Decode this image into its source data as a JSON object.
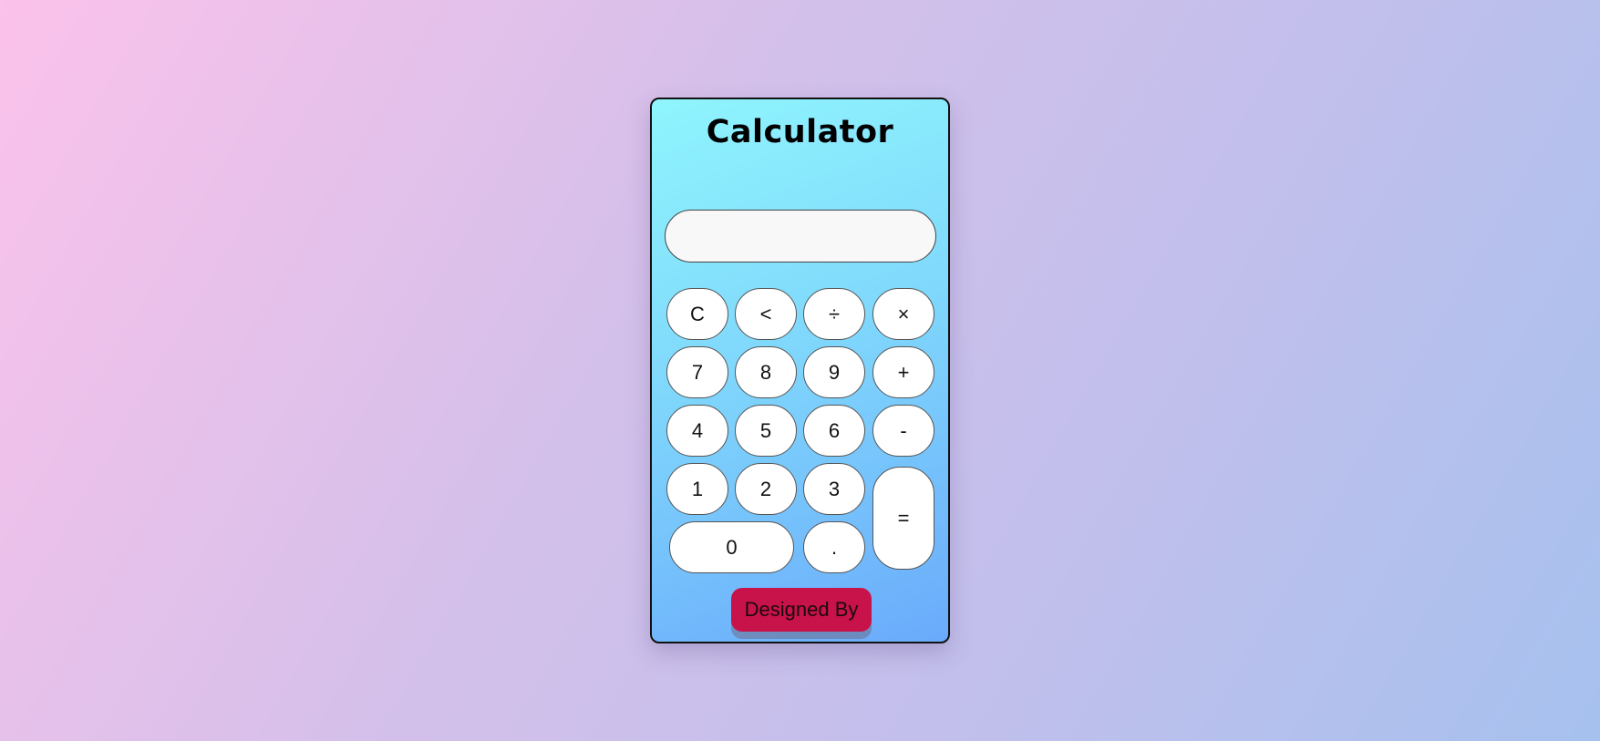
{
  "title": "Calculator",
  "display": {
    "value": ""
  },
  "keys": {
    "clear": "C",
    "backspace": "<",
    "divide": "÷",
    "multiply": "×",
    "seven": "7",
    "eight": "8",
    "nine": "9",
    "plus": "+",
    "four": "4",
    "five": "5",
    "six": "6",
    "minus": "-",
    "one": "1",
    "two": "2",
    "three": "3",
    "equals": "=",
    "zero": "0",
    "decimal": "."
  },
  "footer": {
    "designed_by": "Designed By"
  },
  "colors": {
    "card_gradient_start": "#8ff5fd",
    "card_gradient_end": "#6aaafb",
    "designed_button": "#c8124a",
    "key_background": "#ffffff",
    "display_background": "#f8f8f8"
  }
}
